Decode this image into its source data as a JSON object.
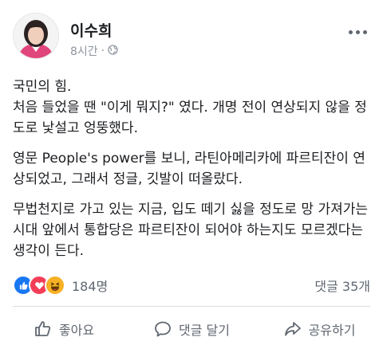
{
  "post": {
    "author": "이수희",
    "time": "8시간",
    "privacy_icon": "globe-icon",
    "paragraphs": [
      "국민의 힘.\n처음 들었을 땐 \"이게 뭐지?\" 였다. 개명 전이 연상되지 않을 정도로 낯설고 엉뚱했다.",
      "영문 People's power를 보니, 라틴아메리카에 파르티잔이 연상되었고, 그래서 정글, 깃발이 떠올랐다.",
      "무법천지로 가고 있는 지금, 입도 떼기 싫을 정도로 망 가져가는 시대 앞에서 통합당은 파르티잔이 되어야 하는지도 모르겠다는 생각이 든다."
    ]
  },
  "stats": {
    "reaction_icons": [
      "like-icon",
      "love-icon",
      "haha-icon"
    ],
    "reactions": "184명",
    "comments": "댓글 35개"
  },
  "actions": {
    "like": "좋아요",
    "comment": "댓글 달기",
    "share": "공유하기"
  },
  "colors": {
    "like": "#1877f2",
    "love": "#f33e58",
    "haha": "#f7b125",
    "text_secondary": "#606770"
  }
}
